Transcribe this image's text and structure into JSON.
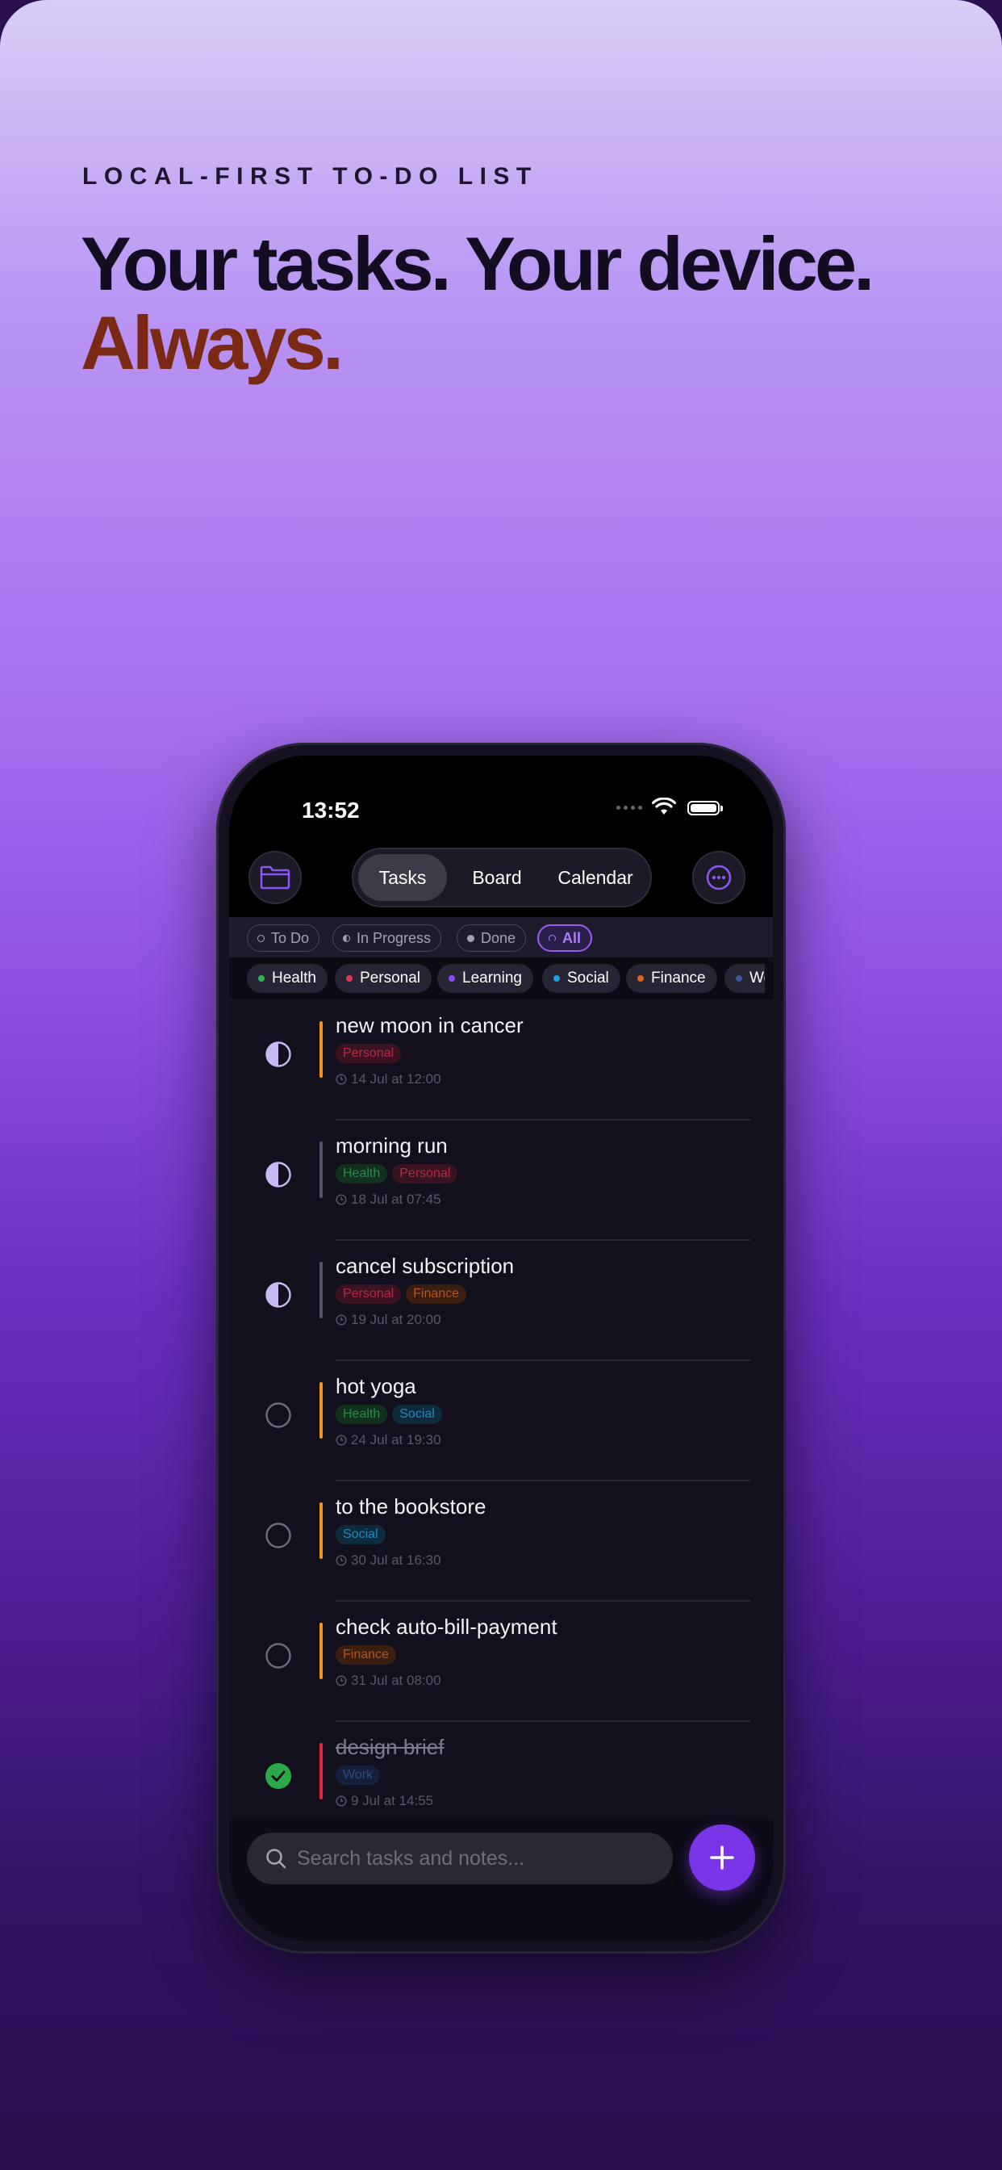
{
  "hero": {
    "eyebrow": "LOCAL-FIRST TO-DO LIST",
    "headline": "Your tasks. Your device.",
    "accent": "Always."
  },
  "phone": {
    "time": "13:52",
    "icons": [
      "signal-icon",
      "wifi-icon",
      "battery-icon",
      "folder-icon",
      "more-icon",
      "search-icon",
      "plus-icon"
    ],
    "segments": [
      {
        "label": "Tasks",
        "active": true
      },
      {
        "label": "Board",
        "active": false
      },
      {
        "label": "Calendar",
        "active": false
      }
    ],
    "status_filters": [
      {
        "label": "To Do",
        "active": false
      },
      {
        "label": "In Progress",
        "active": false
      },
      {
        "label": "Done",
        "active": false
      },
      {
        "label": "All",
        "active": true
      }
    ],
    "category_tags": [
      {
        "label": "Health",
        "color": "#2fb35a"
      },
      {
        "label": "Personal",
        "color": "#e0365e"
      },
      {
        "label": "Learning",
        "color": "#8a4cf2"
      },
      {
        "label": "Social",
        "color": "#1e9fe0"
      },
      {
        "label": "Finance",
        "color": "#e0641e"
      },
      {
        "label": "Wor",
        "color": "#3a5a9a"
      }
    ],
    "tasks": [
      {
        "title": "new moon in cancer",
        "status": "in-progress",
        "priority_color": "#f0951e",
        "tags": [
          "Personal"
        ],
        "due": "14 Jul at 12:00"
      },
      {
        "title": "morning run",
        "status": "in-progress",
        "priority_color": "#55526a",
        "tags": [
          "Health",
          "Personal"
        ],
        "due": "18 Jul at 07:45"
      },
      {
        "title": "cancel subscription",
        "status": "in-progress",
        "priority_color": "#55526a",
        "tags": [
          "Personal",
          "Finance"
        ],
        "due": "19 Jul at 20:00"
      },
      {
        "title": "hot yoga",
        "status": "todo",
        "priority_color": "#f0951e",
        "tags": [
          "Health",
          "Social"
        ],
        "due": "24 Jul at 19:30"
      },
      {
        "title": "to the bookstore",
        "status": "todo",
        "priority_color": "#f0951e",
        "tags": [
          "Social"
        ],
        "due": "30 Jul at 16:30"
      },
      {
        "title": "check auto-bill-payment",
        "status": "todo",
        "priority_color": "#f0951e",
        "tags": [
          "Finance"
        ],
        "due": "31 Jul at 08:00"
      },
      {
        "title": "design brief",
        "status": "done",
        "priority_color": "#e02a3a",
        "tags": [
          "Work"
        ],
        "due": "9 Jul at 14:55"
      }
    ],
    "search": {
      "placeholder": "Search tasks and notes..."
    }
  }
}
